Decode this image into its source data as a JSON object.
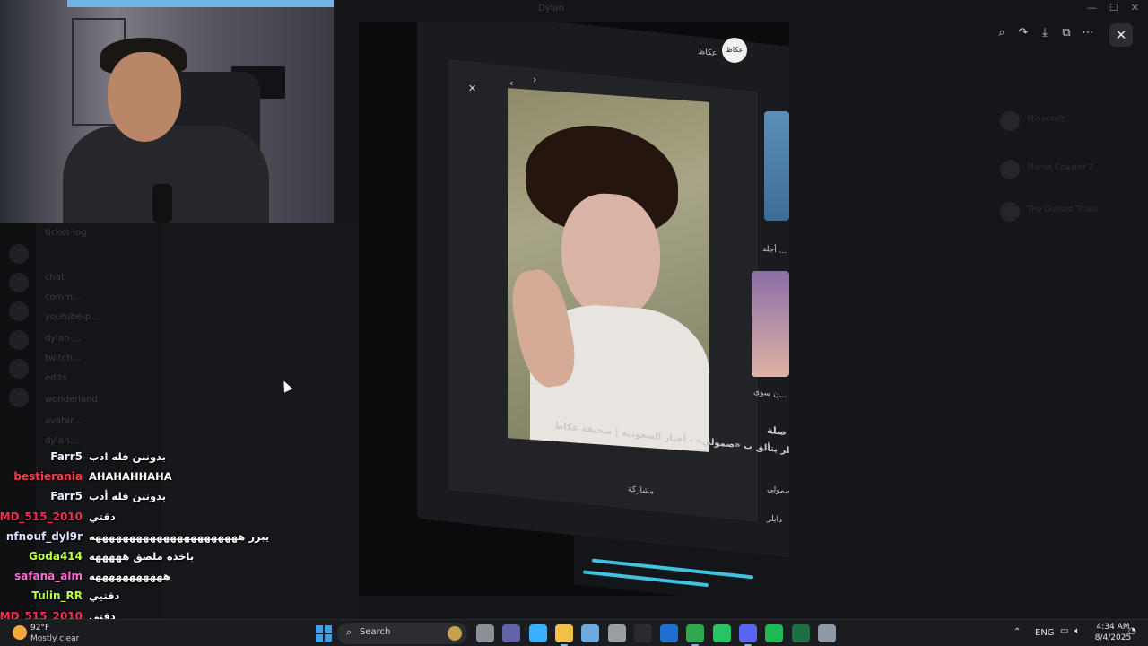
{
  "window": {
    "title": "Dylan",
    "controls": [
      "—",
      "☐",
      "✕"
    ]
  },
  "viewer": {
    "toolbar": [
      "zoom-in",
      "forward",
      "download",
      "open-external",
      "more"
    ],
    "toolbar_glyphs": [
      "⌕",
      "↷",
      "⤓",
      "⧉",
      "⋯"
    ],
    "close_glyph": "✕"
  },
  "background_discord": {
    "channels": [
      "ticket-log",
      "chat",
      "comm...",
      "youtube-p...",
      "dylan-...",
      "twitch...",
      "edits",
      "wonderland",
      "avatar...",
      "dylan..."
    ],
    "right_panel": [
      "Minecraft",
      "Planet Coaster 2",
      "The Outlast Trials"
    ]
  },
  "photo": {
    "screen_header": "عكاظ",
    "avatar_text": "عكاظ",
    "caption_title": "دايلر يتألق ب «صمولي» - أخبار السعودية | صحيفة عكاظ",
    "share_label": "مشاركة",
    "side_labels": [
      "صلة",
      "صمولي",
      "دايلر",
      "أجلد ..."
    ],
    "more_label": "ن سوى..."
  },
  "chat": {
    "messages": [
      {
        "user": "Farr5",
        "color": "#e8f0ff",
        "text": "بدوننن فله ادب"
      },
      {
        "user": "bestierania",
        "color": "#ff3b4f",
        "text": "AHAHAHHAHA"
      },
      {
        "user": "Farr5",
        "color": "#e8f0ff",
        "text": "بدوننن فله أدب"
      },
      {
        "user": "MD_515_2010",
        "color": "#ff2a55",
        "text": "دقتي"
      },
      {
        "user": "nfnouf_dyl9r",
        "color": "#d8e4ff",
        "text": "يبرر ههههههههههههههههههههههه"
      },
      {
        "user": "Goda414",
        "color": "#b7ff4a",
        "text": "باخذه ملصق هههههه"
      },
      {
        "user": "safana_alm",
        "color": "#ff6ad5",
        "text": "هههههههههههه"
      },
      {
        "user": "Tulin_RR",
        "color": "#b7ff4a",
        "text": "دقتيي"
      },
      {
        "user": "MD_515_2010",
        "color": "#ff2a55",
        "text": "دقتي"
      }
    ]
  },
  "taskbar": {
    "weather_temp": "92°F",
    "weather_desc": "Mostly clear",
    "search_label": "Search",
    "language": "ENG",
    "time": "4:34 AM",
    "date": "8/4/2025",
    "apps": [
      {
        "name": "file-manager",
        "color": "#8c8f96"
      },
      {
        "name": "teams",
        "color": "#6264a7"
      },
      {
        "name": "copilot",
        "color": "#3ab0ff"
      },
      {
        "name": "explorer",
        "color": "#f2c14a"
      },
      {
        "name": "store",
        "color": "#6fa8dc"
      },
      {
        "name": "settings",
        "color": "#9a9da4"
      },
      {
        "name": "obs",
        "color": "#2a2b30"
      },
      {
        "name": "outlook",
        "color": "#1f6fd1"
      },
      {
        "name": "chrome",
        "color": "#2fa84f"
      },
      {
        "name": "whatsapp",
        "color": "#27c462"
      },
      {
        "name": "discord",
        "color": "#5865f2"
      },
      {
        "name": "spotify",
        "color": "#1db954"
      },
      {
        "name": "excel",
        "color": "#1d7044"
      },
      {
        "name": "telegram",
        "color": "#8f98a6"
      }
    ]
  }
}
